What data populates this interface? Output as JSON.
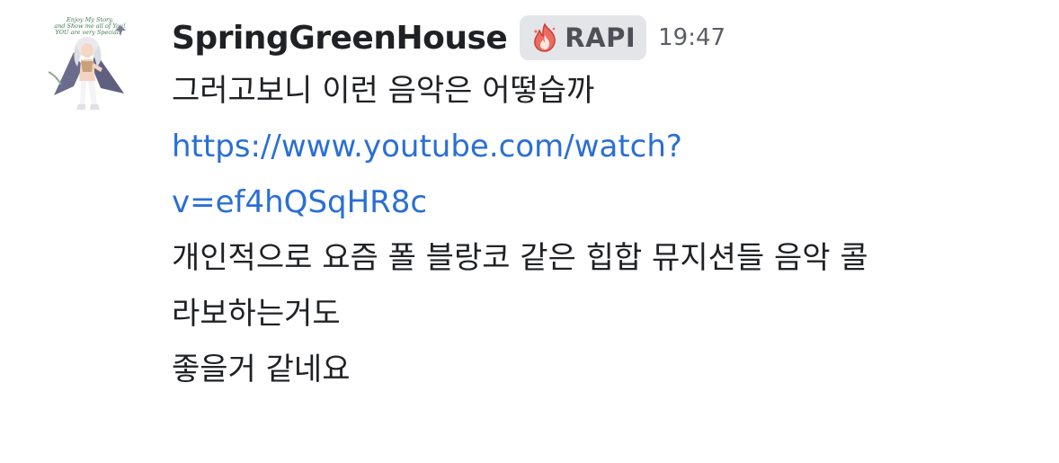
{
  "message": {
    "author": {
      "username": "SpringGreenHouse",
      "avatar_icon": "anime-character-avatar",
      "avatar_caption": [
        "Enjoy My Story,",
        "and Show me all of You!",
        "YOU are very Special!"
      ]
    },
    "server_tag": {
      "icon": "flame-icon",
      "label": "RAPI",
      "accent": "#e8524f"
    },
    "timestamp": "19:47",
    "lines": {
      "first": "그러고보니 이런 음악은 어떻습까",
      "link_part1": "https://www.youtube.com/watch?",
      "link_part2": "v=ef4hQSqHR8c",
      "second_a": "개인적으로 요즘 폴 블랑코 같은 힙합 뮤지션들 음악 콜",
      "second_b": "라보하는거도",
      "third": "좋을거 같네요"
    },
    "colors": {
      "username": "#1f2124",
      "text": "#1f2124",
      "link": "#2a6fd4",
      "timestamp": "#5c5e66",
      "tag_background": "#e4e5e8"
    }
  }
}
